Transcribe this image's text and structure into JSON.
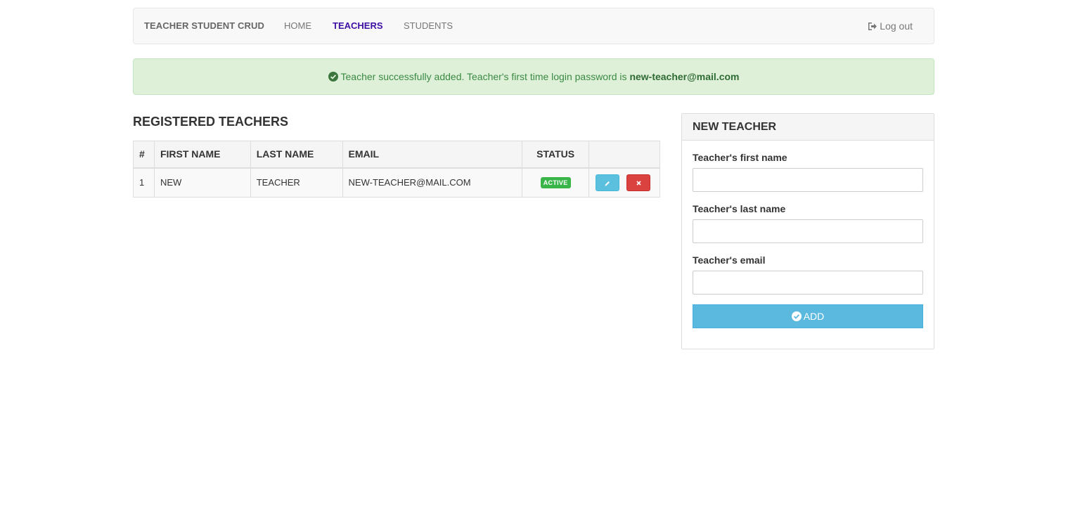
{
  "navbar": {
    "brand": "TEACHER STUDENT CRUD",
    "links": [
      {
        "label": "HOME",
        "active": false
      },
      {
        "label": "TEACHERS",
        "active": true
      },
      {
        "label": "STUDENTS",
        "active": false
      }
    ],
    "logout_label": "Log out",
    "logout_icon": "sign-out-icon"
  },
  "alert": {
    "icon": "check-circle-icon",
    "message": "Teacher successfully added. Teacher's first time login password is ",
    "password": "new-teacher@mail.com"
  },
  "teachers": {
    "title": "REGISTERED TEACHERS",
    "columns": [
      "#",
      "FIRST NAME",
      "LAST NAME",
      "EMAIL",
      "STATUS",
      ""
    ],
    "rows": [
      {
        "num": "1",
        "first_name": "NEW",
        "last_name": "TEACHER",
        "email": "NEW-TEACHER@MAIL.COM",
        "status": "ACTIVE"
      }
    ],
    "edit_icon": "pencil-icon",
    "delete_icon": "close-icon"
  },
  "new_teacher": {
    "title": "NEW TEACHER",
    "first_name_label": "Teacher's first name",
    "first_name_value": "",
    "last_name_label": "Teacher's last name",
    "last_name_value": "",
    "email_label": "Teacher's email",
    "email_value": "",
    "add_label": "ADD",
    "add_icon": "check-circle-icon"
  },
  "colors": {
    "nav_active": "#3d0fa5",
    "alert_bg": "#dff0d8",
    "alert_text": "#3c763d",
    "badge_active": "#3ab54a",
    "btn_edit": "#5bc0de",
    "btn_delete": "#d9423f",
    "btn_add": "#5bb9e0"
  }
}
